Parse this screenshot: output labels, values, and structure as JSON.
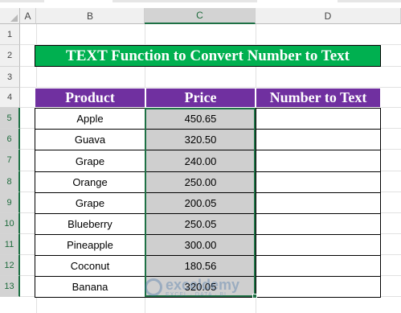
{
  "columns": [
    "A",
    "B",
    "C",
    "D"
  ],
  "rows": [
    "1",
    "2",
    "3",
    "4",
    "5",
    "6",
    "7",
    "8",
    "9",
    "10",
    "11",
    "12",
    "13"
  ],
  "active_column": "C",
  "selected_rows": [
    "5",
    "6",
    "7",
    "8",
    "9",
    "10",
    "11",
    "12",
    "13"
  ],
  "title": "TEXT Function to Convert Number to Text",
  "table": {
    "headers": [
      "Product",
      "Price",
      "Number to Text"
    ],
    "rows": [
      {
        "product": "Apple",
        "price": "450.65",
        "text": ""
      },
      {
        "product": "Guava",
        "price": "320.50",
        "text": ""
      },
      {
        "product": "Grape",
        "price": "240.00",
        "text": ""
      },
      {
        "product": "Orange",
        "price": "250.00",
        "text": ""
      },
      {
        "product": "Grape",
        "price": "200.05",
        "text": ""
      },
      {
        "product": "Blueberry",
        "price": "250.05",
        "text": ""
      },
      {
        "product": "Pineapple",
        "price": "300.00",
        "text": ""
      },
      {
        "product": "Coconut",
        "price": "180.56",
        "text": ""
      },
      {
        "product": "Banana",
        "price": "320.05",
        "text": ""
      }
    ]
  },
  "watermark": {
    "name": "exceldemy",
    "tagline": "EXCEL · DATA · BI"
  },
  "colors": {
    "title_bg": "#00b050",
    "header_bg": "#7030a0",
    "selection": "#1e7145"
  }
}
